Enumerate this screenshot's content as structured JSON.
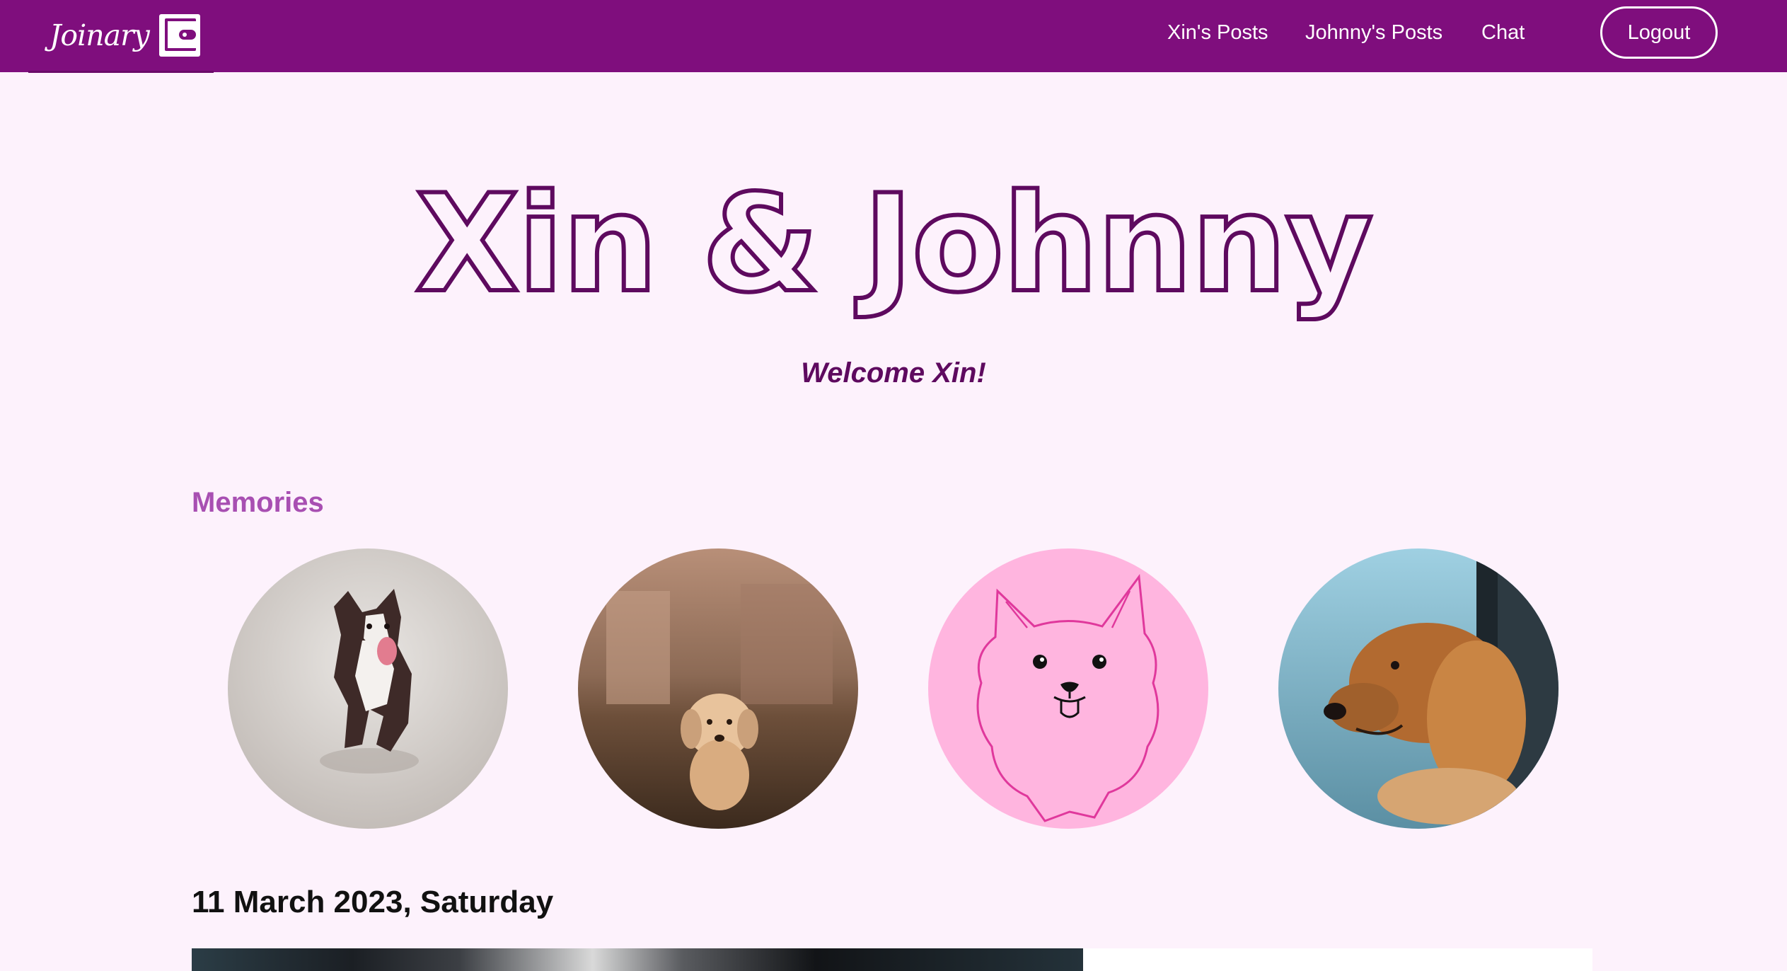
{
  "nav": {
    "brand": "Joinary",
    "links": [
      "Xin's Posts",
      "Johnny's Posts",
      "Chat"
    ],
    "logout_label": "Logout"
  },
  "hero": {
    "title": "Xin & Johnny",
    "welcome": "Welcome Xin!"
  },
  "memories": {
    "heading": "Memories",
    "items": [
      "running-dog-photo",
      "golden-puppy-photo",
      "pomeranian-drawing",
      "spaniel-car-window-photo"
    ]
  },
  "post": {
    "date": "11 March 2023, Saturday"
  },
  "colors": {
    "nav_bg": "#7f0e7d",
    "page_bg": "#fdf2fc",
    "title_stroke": "#5e0a5f",
    "memories_heading": "#a84fb2",
    "drawing_bg": "#ffb5df",
    "drawing_line": "#e0389c"
  }
}
